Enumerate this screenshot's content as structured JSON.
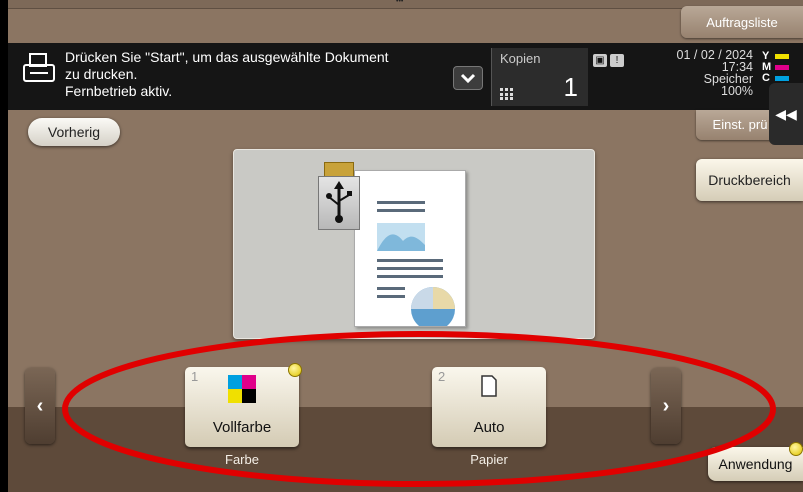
{
  "header": {
    "job_list_label": "Auftragsliste",
    "message_line1": "Drücken Sie \"Start\", um das ausgewählte Dokument",
    "message_line2": "zu drucken.",
    "message_line3": "Fernbetrieb aktiv.",
    "copies_label": "Kopien",
    "copies_value": "1",
    "date": "01 / 02 / 2024",
    "time": "17:34",
    "memory_label": "Speicher",
    "memory_value": "100%",
    "toner": [
      {
        "letter": "Y",
        "color": "#f0e000"
      },
      {
        "letter": "M",
        "color": "#e0008a"
      },
      {
        "letter": "C",
        "color": "#00a0e0"
      }
    ]
  },
  "nav": {
    "prev_label": "Vorherig",
    "check_settings_label": "Einst. prü",
    "print_area_label": "Druckbereich",
    "apply_label": "Anwendung"
  },
  "functions": [
    {
      "index": "1",
      "name": "Vollfarbe",
      "caption": "Farbe"
    },
    {
      "index": "2",
      "name": "Auto",
      "caption": "Papier"
    }
  ],
  "colors": {
    "background": "#8b7562",
    "status_bar": "#151515",
    "highlight": "#e00000"
  }
}
